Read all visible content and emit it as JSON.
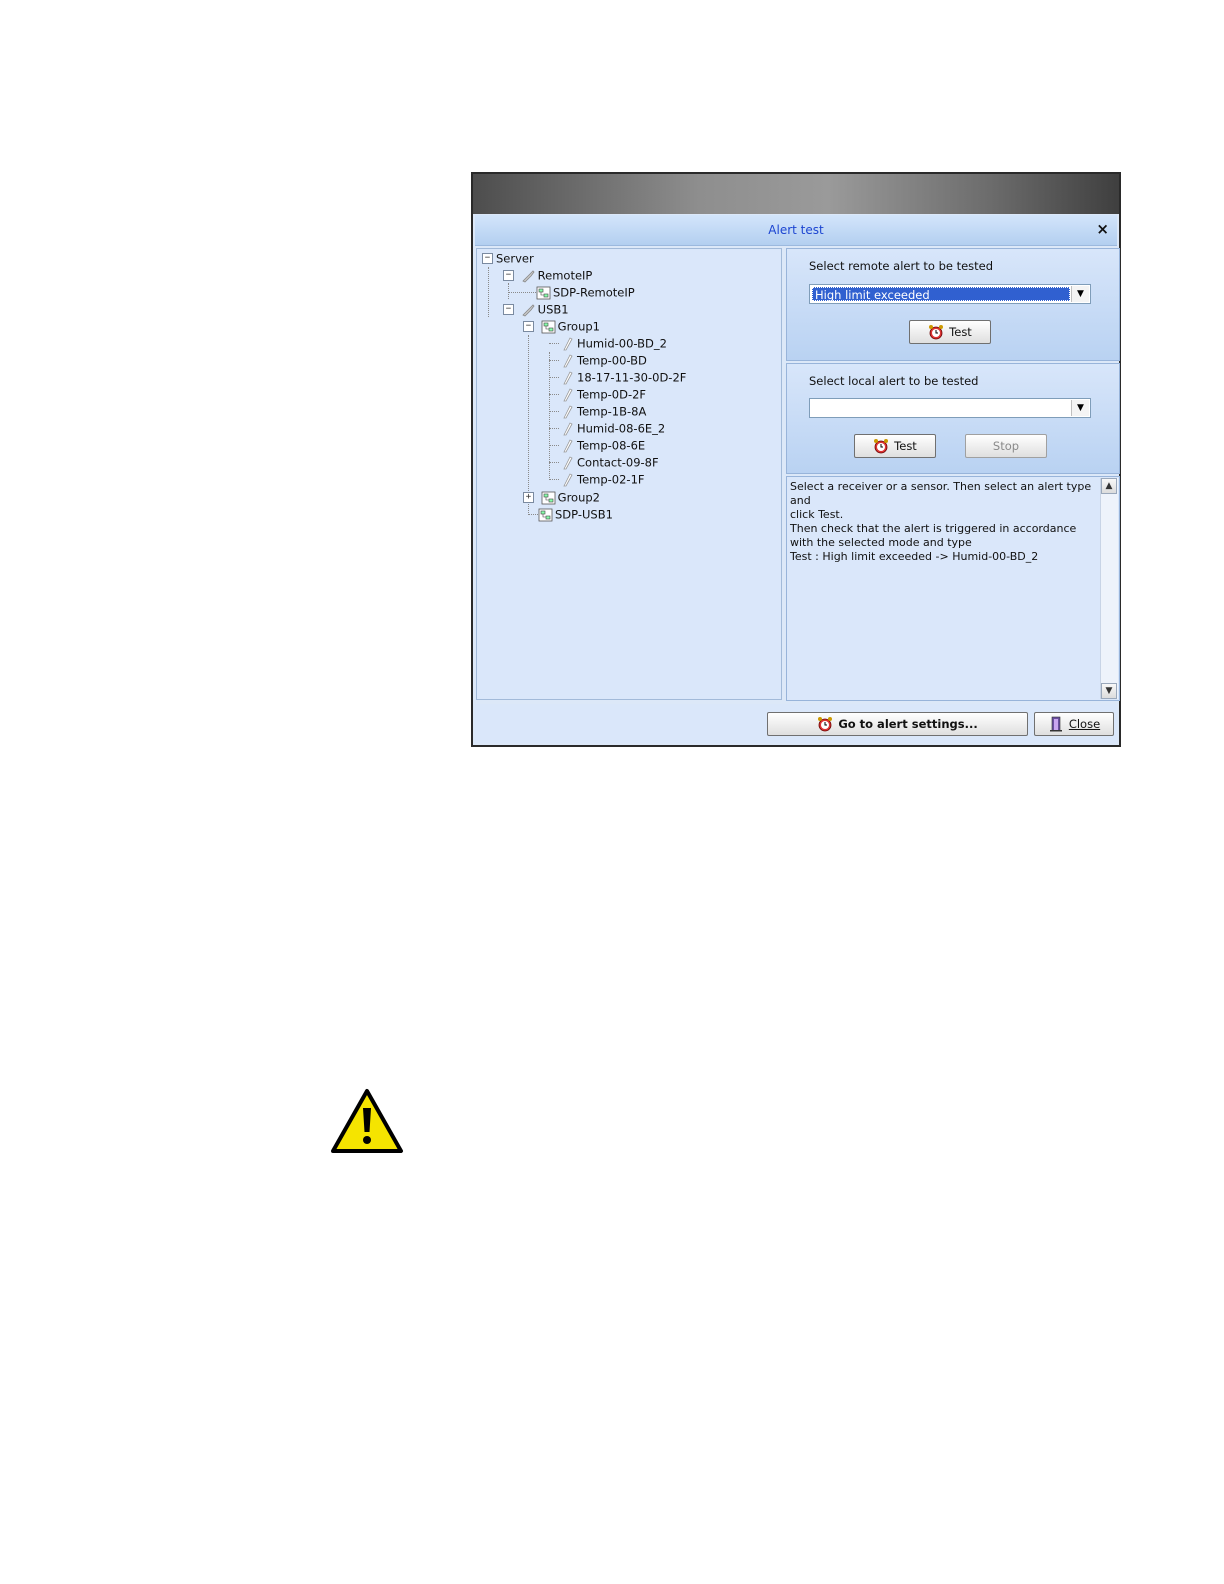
{
  "window": {
    "title": "Alert test",
    "close_glyph": "×"
  },
  "tree": {
    "nodes": [
      {
        "label": "Server",
        "icon": "none",
        "expander": "−"
      },
      {
        "label": "RemoteIP",
        "icon": "receiver-icon",
        "expander": "−"
      },
      {
        "label": "SDP-RemoteIP",
        "icon": "network-icon"
      },
      {
        "label": "USB1",
        "icon": "receiver-icon",
        "expander": "−"
      },
      {
        "label": "Group1",
        "icon": "network-icon",
        "expander": "−"
      },
      {
        "label": "Humid-00-BD_2",
        "icon": "sensor-icon"
      },
      {
        "label": "Temp-00-BD",
        "icon": "sensor-icon"
      },
      {
        "label": "18-17-11-30-0D-2F",
        "icon": "sensor-icon"
      },
      {
        "label": "Temp-0D-2F",
        "icon": "sensor-icon"
      },
      {
        "label": "Temp-1B-8A",
        "icon": "sensor-icon"
      },
      {
        "label": "Humid-08-6E_2",
        "icon": "sensor-icon"
      },
      {
        "label": "Temp-08-6E",
        "icon": "sensor-icon"
      },
      {
        "label": "Contact-09-8F",
        "icon": "sensor-icon"
      },
      {
        "label": "Temp-02-1F",
        "icon": "sensor-icon"
      },
      {
        "label": "Group2",
        "icon": "network-icon",
        "expander": "+"
      },
      {
        "label": "SDP-USB1",
        "icon": "network-icon"
      }
    ]
  },
  "remote": {
    "label": "Select remote alert to be tested",
    "selected": "High limit exceeded",
    "test_label": "Test"
  },
  "local": {
    "label": "Select local alert to be tested",
    "selected": "",
    "test_label": "Test",
    "stop_label": "Stop"
  },
  "log": {
    "lines": [
      "Select a receiver or a sensor. Then select an alert type and",
      "click Test.",
      "Then check that the alert is triggered in accordance",
      "with the selected mode and type",
      "Test : High limit exceeded -> Humid-00-BD_2"
    ]
  },
  "footer": {
    "settings_label": "Go to alert settings...",
    "close_label": "Close"
  },
  "colors": {
    "title_text": "#1c45d1",
    "panel_bg": "#dae7fa",
    "selection": "#3060d0",
    "warning_yellow": "#f5e400"
  }
}
